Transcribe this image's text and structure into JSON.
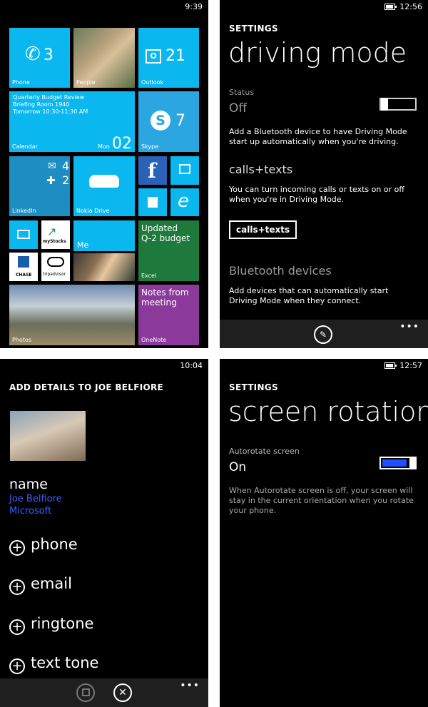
{
  "start": {
    "time": "9:39",
    "phone": {
      "label": "Phone",
      "count": "3"
    },
    "people": {
      "label": "People"
    },
    "outlook": {
      "label": "Outlook",
      "count": "21"
    },
    "calendar": {
      "label": "Calendar",
      "event_line1": "Quarterly Budget Review",
      "event_line2": "Briefing Room 1940",
      "event_line3": "Tomorrow 10:30-11:30 AM",
      "day": "Mon",
      "date": "02"
    },
    "skype": {
      "label": "Skype",
      "count": "7"
    },
    "linkedin": {
      "label": "LinkedIn",
      "mail_count": "4",
      "people_count": "2"
    },
    "nokia_drive": {
      "label": "Nokia Drive"
    },
    "mystocks": {
      "label": "myStocks"
    },
    "chase": {
      "label": "CHASE"
    },
    "tripadvisor": {
      "label": "tripadvisor"
    },
    "me": {
      "label": "Me"
    },
    "excel": {
      "label": "Excel",
      "text_line1": "Updated",
      "text_line2": "Q-2 budget"
    },
    "photos": {
      "label": "Photos"
    },
    "onenote": {
      "label": "OneNote",
      "text_line1": "Notes from",
      "text_line2": "meeting"
    }
  },
  "driving": {
    "time": "12:56",
    "section": "SETTINGS",
    "title": "driving mode",
    "status_label": "Status",
    "status_value": "Off",
    "description": "Add a Bluetooth device to have Driving Mode start up automatically when you're driving.",
    "calls_heading": "calls+texts",
    "calls_description": "You can turn incoming calls or texts on or off when you're in Driving Mode.",
    "calls_button": "calls+texts",
    "bt_heading": "Bluetooth devices",
    "bt_description": "Add devices that can automatically start Driving Mode when they connect.",
    "more": "•••"
  },
  "contact": {
    "time": "10:04",
    "title": "ADD DETAILS TO JOE BELFIORE",
    "name_label": "name",
    "name_value": "Joe Belfiore",
    "company_value": "Microsoft",
    "phone": "phone",
    "email": "email",
    "ringtone": "ringtone",
    "texttone": "text tone",
    "more": "•••"
  },
  "rotation": {
    "time": "12:57",
    "section": "SETTINGS",
    "title": "screen rotation",
    "setting_label": "Autorotate screen",
    "setting_value": "On",
    "description": "When Autorotate screen is off, your screen will stay in the current orientation when you rotate your phone."
  },
  "colors": {
    "accent_cyan": "#0bb7ef",
    "skype_blue": "#2ba6e1",
    "excel_green": "#1e7a3c",
    "onenote_purple": "#8b3a9c",
    "toggle_blue": "#1f4fff",
    "link_blue": "#3b5fff"
  }
}
